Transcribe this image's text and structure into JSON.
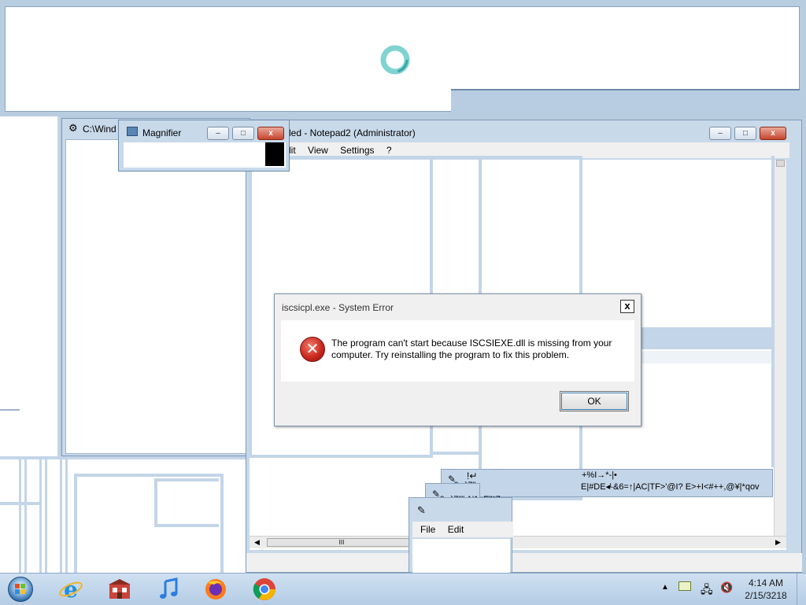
{
  "top_window": {
    "spinner": "loading-ring"
  },
  "explorer": {
    "title": "C:\\Wind"
  },
  "magnifier": {
    "title": "Magnifier",
    "min": "–",
    "max": "□",
    "close": "x"
  },
  "notepad": {
    "title": "led - Notepad2 (Administrator)",
    "menu": [
      "dit",
      "View",
      "Settings",
      "?"
    ],
    "min": "–",
    "max": "□",
    "close": "x",
    "scroll_grip": "III"
  },
  "garbled": {
    "line1": "!↵",
    "line2": "-0┬)7\"",
    "line3": "-0┬)7\"\" A'1   ,E\"*7",
    "right1": "+%I→*-|•",
    "right2": "E|#DE◂ᴸ&6=↑|AC|TF>'@I? E>+I<#++,@¥|*qov"
  },
  "small_notepad": {
    "menu": [
      "File",
      "Edit"
    ]
  },
  "dialog": {
    "title": "iscsicpl.exe - System Error",
    "close": "x",
    "message_line1": "The program can't start because ISCSIEXE.dll is missing from your",
    "message_line2": "computer. Try reinstalling the program to fix this problem.",
    "ok_label": "OK"
  },
  "taskbar": {
    "icons": [
      "start-orb",
      "internet-explorer",
      "media-center",
      "itunes",
      "firefox",
      "chrome"
    ],
    "time": "4:14 AM",
    "date": "2/15/3218"
  }
}
